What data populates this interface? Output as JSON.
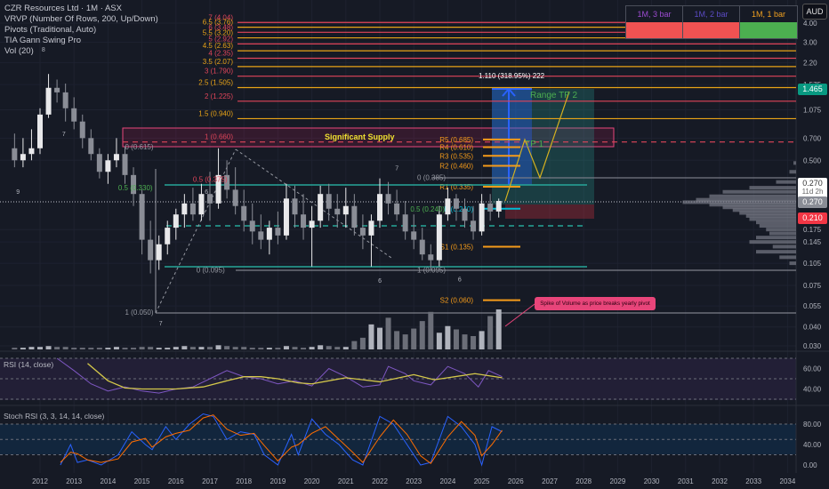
{
  "legend": {
    "symbol": "CZR Resources Ltd · 1M · ASX",
    "indicators": [
      "VRVP (Number Of Rows, 200, Up/Down)",
      "Pivots (Traditional, Auto)",
      "TIA Gann Swing Pro",
      "Vol (20)"
    ]
  },
  "currency": "AUD",
  "bar_table": {
    "headers": [
      "1M, 3 bar",
      "1M, 2 bar",
      "1M, 1 bar"
    ],
    "header_colors": [
      "#9c4bd1",
      "#5b4bc4",
      "#f0a020"
    ],
    "cell_colors": [
      "#f05252",
      "#f05252",
      "#4caf50"
    ]
  },
  "price_badges": {
    "target": "1.465",
    "last": "0.270",
    "countdown": "11d 2h",
    "close": "0.270",
    "stop": "0.210"
  },
  "rsi": {
    "title": "RSI (14, close)"
  },
  "stoch": {
    "title": "Stoch RSI (3, 3, 14, 14, close)"
  },
  "callout": "Spike of Volume as  price breaks yearly pivot",
  "annotations": {
    "significant_supply": "Significant Supply",
    "measure": "1.110 (318.95%) 222",
    "tp2": "Range TP 2",
    "tp1": "TP 1"
  },
  "chart_data": {
    "type": "candlestick",
    "title": "CZR Resources Ltd · 1M · ASX",
    "y_scale": "log",
    "price_axis_ticks": [
      "4.00",
      "3.00",
      "2.20",
      "1.575",
      "1.075",
      "0.700",
      "0.500",
      "0.175",
      "0.145",
      "0.105",
      "0.075",
      "0.055",
      "0.040",
      "0.030"
    ],
    "price_axis_values": [
      4.0,
      3.0,
      2.2,
      1.575,
      1.075,
      0.7,
      0.5,
      0.175,
      0.145,
      0.105,
      0.075,
      0.055,
      0.04,
      0.03
    ],
    "time_axis_ticks": [
      "2012",
      "2013",
      "2014",
      "2015",
      "2016",
      "2017",
      "2018",
      "2019",
      "2020",
      "2021",
      "2022",
      "2023",
      "2024",
      "2025",
      "2026",
      "2027",
      "2028",
      "2029",
      "2030",
      "2031",
      "2032",
      "2033",
      "2034"
    ],
    "ohlc_quarterly": [
      [
        2011.25,
        0.6,
        0.75,
        0.45,
        0.5
      ],
      [
        2011.5,
        0.5,
        0.7,
        0.45,
        0.55
      ],
      [
        2011.75,
        0.55,
        0.8,
        0.5,
        0.6
      ],
      [
        2012.0,
        0.6,
        1.1,
        0.55,
        1.0
      ],
      [
        2012.25,
        1.0,
        1.85,
        0.95,
        1.5
      ],
      [
        2012.5,
        1.5,
        1.7,
        1.2,
        1.4
      ],
      [
        2012.75,
        1.4,
        1.6,
        0.9,
        1.1
      ],
      [
        2013.0,
        1.1,
        1.3,
        0.8,
        0.9
      ],
      [
        2013.25,
        0.9,
        1.0,
        0.6,
        0.7
      ],
      [
        2013.5,
        0.7,
        0.8,
        0.5,
        0.55
      ],
      [
        2013.75,
        0.55,
        0.6,
        0.38,
        0.42
      ],
      [
        2014.0,
        0.42,
        0.55,
        0.35,
        0.5
      ],
      [
        2014.25,
        0.5,
        0.7,
        0.45,
        0.55
      ],
      [
        2014.5,
        0.55,
        0.62,
        0.35,
        0.4
      ],
      [
        2014.75,
        0.4,
        0.45,
        0.25,
        0.3
      ],
      [
        2015.0,
        0.3,
        0.32,
        0.12,
        0.15
      ],
      [
        2015.25,
        0.15,
        0.2,
        0.09,
        0.11
      ],
      [
        2015.5,
        0.11,
        0.16,
        0.095,
        0.14
      ],
      [
        2015.75,
        0.14,
        0.2,
        0.12,
        0.18
      ],
      [
        2016.0,
        0.18,
        0.24,
        0.15,
        0.22
      ],
      [
        2016.25,
        0.22,
        0.3,
        0.18,
        0.26
      ],
      [
        2016.5,
        0.26,
        0.33,
        0.2,
        0.22
      ],
      [
        2016.75,
        0.22,
        0.35,
        0.2,
        0.3
      ],
      [
        2017.0,
        0.3,
        0.42,
        0.2,
        0.26
      ],
      [
        2017.25,
        0.26,
        0.6,
        0.24,
        0.4
      ],
      [
        2017.5,
        0.4,
        0.5,
        0.28,
        0.32
      ],
      [
        2017.75,
        0.32,
        0.45,
        0.22,
        0.25
      ],
      [
        2018.0,
        0.25,
        0.32,
        0.17,
        0.2
      ],
      [
        2018.25,
        0.2,
        0.26,
        0.14,
        0.17
      ],
      [
        2018.5,
        0.17,
        0.22,
        0.13,
        0.15
      ],
      [
        2018.75,
        0.15,
        0.2,
        0.12,
        0.18
      ],
      [
        2019.0,
        0.18,
        0.23,
        0.14,
        0.16
      ],
      [
        2019.25,
        0.16,
        0.35,
        0.15,
        0.28
      ],
      [
        2019.5,
        0.28,
        0.34,
        0.18,
        0.22
      ],
      [
        2019.75,
        0.22,
        0.3,
        0.15,
        0.18
      ],
      [
        2020.0,
        0.18,
        0.25,
        0.1,
        0.2
      ],
      [
        2020.25,
        0.2,
        0.34,
        0.18,
        0.3
      ],
      [
        2020.5,
        0.3,
        0.35,
        0.2,
        0.24
      ],
      [
        2020.75,
        0.24,
        0.3,
        0.18,
        0.22
      ],
      [
        2021.0,
        0.22,
        0.33,
        0.18,
        0.25
      ],
      [
        2021.25,
        0.25,
        0.3,
        0.16,
        0.18
      ],
      [
        2021.5,
        0.18,
        0.22,
        0.13,
        0.16
      ],
      [
        2021.75,
        0.16,
        0.22,
        0.1,
        0.2
      ],
      [
        2022.0,
        0.2,
        0.38,
        0.18,
        0.3
      ],
      [
        2022.25,
        0.3,
        0.36,
        0.22,
        0.26
      ],
      [
        2022.5,
        0.26,
        0.32,
        0.2,
        0.22
      ],
      [
        2022.75,
        0.22,
        0.27,
        0.15,
        0.17
      ],
      [
        2023.0,
        0.17,
        0.22,
        0.13,
        0.15
      ],
      [
        2023.25,
        0.15,
        0.18,
        0.11,
        0.12
      ],
      [
        2023.5,
        0.12,
        0.14,
        0.095,
        0.11
      ],
      [
        2023.75,
        0.11,
        0.25,
        0.1,
        0.22
      ],
      [
        2024.0,
        0.22,
        0.33,
        0.2,
        0.28
      ],
      [
        2024.25,
        0.28,
        0.3,
        0.2,
        0.24
      ],
      [
        2024.5,
        0.24,
        0.28,
        0.18,
        0.2
      ],
      [
        2024.75,
        0.2,
        0.25,
        0.15,
        0.17
      ],
      [
        2025.0,
        0.17,
        0.3,
        0.16,
        0.26
      ],
      [
        2025.25,
        0.26,
        0.3,
        0.2,
        0.23
      ],
      [
        2025.5,
        0.23,
        0.28,
        0.21,
        0.27
      ]
    ],
    "volume_relative": [
      2,
      2,
      3,
      3,
      4,
      3,
      3,
      2,
      2,
      2,
      2,
      2,
      3,
      2,
      2,
      3,
      3,
      2,
      2,
      3,
      4,
      3,
      3,
      3,
      5,
      4,
      3,
      3,
      2,
      2,
      2,
      2,
      4,
      3,
      2,
      3,
      5,
      4,
      3,
      3,
      10,
      14,
      30,
      26,
      38,
      22,
      18,
      25,
      34,
      45,
      20,
      28,
      24,
      18,
      16,
      22,
      40,
      48
    ],
    "gann_levels": [
      {
        "label": "7 (4.04)",
        "price": 4.04,
        "color": "#e0455a"
      },
      {
        "label": "6.5 (3.76)",
        "price": 3.76,
        "color": "#e8a317"
      },
      {
        "label": "6 (3.48)",
        "price": 3.48,
        "color": "#e0455a"
      },
      {
        "label": "5.5 (3.20)",
        "price": 3.2,
        "color": "#e8a317"
      },
      {
        "label": "5 (2.92)",
        "price": 2.92,
        "color": "#e0455a"
      },
      {
        "label": "4.5 (2.63)",
        "price": 2.63,
        "color": "#e8a317"
      },
      {
        "label": "4 (2.35)",
        "price": 2.35,
        "color": "#e0455a"
      },
      {
        "label": "3.5 (2.07)",
        "price": 2.07,
        "color": "#e8a317"
      },
      {
        "label": "3 (1.790)",
        "price": 1.79,
        "color": "#e0455a"
      },
      {
        "label": "2.5 (1.505)",
        "price": 1.505,
        "color": "#e8a317"
      },
      {
        "label": "2 (1.225)",
        "price": 1.225,
        "color": "#e0455a"
      },
      {
        "label": "1.5 (0.940)",
        "price": 0.94,
        "color": "#e8a317"
      },
      {
        "label": "1 (0.660)",
        "price": 0.66,
        "color": "#e0455a"
      }
    ],
    "pivots": [
      {
        "label": "R5 (0.685)",
        "price": 0.685
      },
      {
        "label": "R4 (0.610)",
        "price": 0.61
      },
      {
        "label": "R3 (0.535)",
        "price": 0.535
      },
      {
        "label": "R2 (0.460)",
        "price": 0.46
      },
      {
        "label": "R1 (0.335)",
        "price": 0.335
      },
      {
        "label": "P (0.240)",
        "price": 0.24
      },
      {
        "label": "S1 (0.135)",
        "price": 0.135
      },
      {
        "label": "S2 (0.060)",
        "price": 0.06
      }
    ],
    "fib_labels": [
      {
        "label": "0 (0.615)",
        "price": 0.615,
        "t": 2014.5,
        "color": "#9598a1"
      },
      {
        "label": "0.5 (0.375)",
        "price": 0.375,
        "t": 2016.5,
        "color": "#e0455a"
      },
      {
        "label": "0.5 (0.330)",
        "price": 0.33,
        "t": 2014.3,
        "color": "#4caf50"
      },
      {
        "label": "0 (0.095)",
        "price": 0.095,
        "t": 2016.6,
        "color": "#9598a1"
      },
      {
        "label": "1 (0.050)",
        "price": 0.05,
        "t": 2014.5,
        "color": "#9598a1"
      },
      {
        "label": "0 (0.385)",
        "price": 0.385,
        "t": 2023.1,
        "color": "#9598a1"
      },
      {
        "label": "0.5 (0.240)",
        "price": 0.24,
        "t": 2022.9,
        "color": "#4caf50"
      },
      {
        "label": "1 (0.095)",
        "price": 0.095,
        "t": 2023.1,
        "color": "#9598a1"
      }
    ],
    "swing_counts": [
      {
        "label": "8",
        "t": 2012.05,
        "price": 2.6
      },
      {
        "label": "7",
        "t": 2012.65,
        "price": 0.72
      },
      {
        "label": "9",
        "t": 2011.3,
        "price": 0.3
      },
      {
        "label": "7",
        "t": 2015.5,
        "price": 0.041
      },
      {
        "label": "6",
        "t": 2016.85,
        "price": 0.3
      },
      {
        "label": "7",
        "t": 2022.45,
        "price": 0.43
      },
      {
        "label": "6",
        "t": 2021.95,
        "price": 0.078
      },
      {
        "label": "6",
        "t": 2024.3,
        "price": 0.08
      }
    ],
    "vrvp": [
      [
        0.48,
        4
      ],
      [
        0.42,
        10
      ],
      [
        0.36,
        30
      ],
      [
        0.33,
        70
      ],
      [
        0.31,
        110
      ],
      [
        0.29,
        130
      ],
      [
        0.275,
        150
      ],
      [
        0.265,
        170
      ],
      [
        0.255,
        130
      ],
      [
        0.245,
        110
      ],
      [
        0.235,
        95
      ],
      [
        0.225,
        85
      ],
      [
        0.215,
        75
      ],
      [
        0.205,
        70
      ],
      [
        0.195,
        60
      ],
      [
        0.185,
        55
      ],
      [
        0.175,
        45
      ],
      [
        0.165,
        40
      ],
      [
        0.155,
        60
      ],
      [
        0.145,
        70
      ],
      [
        0.135,
        35
      ],
      [
        0.125,
        60
      ],
      [
        0.115,
        25
      ],
      [
        0.105,
        10
      ]
    ],
    "rsi": {
      "ticks": [
        "60.00",
        "40.00"
      ],
      "tick_values": [
        60,
        40
      ],
      "bands": [
        70,
        50,
        30
      ],
      "line": [
        [
          2012.5,
          70
        ],
        [
          2013,
          58
        ],
        [
          2013.5,
          45
        ],
        [
          2014,
          38
        ],
        [
          2014.5,
          42
        ],
        [
          2015,
          38
        ],
        [
          2015.5,
          36
        ],
        [
          2016,
          40
        ],
        [
          2016.5,
          42
        ],
        [
          2017,
          50
        ],
        [
          2017.5,
          58
        ],
        [
          2018,
          52
        ],
        [
          2018.5,
          50
        ],
        [
          2019,
          45
        ],
        [
          2019.5,
          48
        ],
        [
          2020,
          43
        ],
        [
          2020.5,
          60
        ],
        [
          2021,
          52
        ],
        [
          2021.5,
          42
        ],
        [
          2022,
          44
        ],
        [
          2022.25,
          62
        ],
        [
          2022.75,
          55
        ],
        [
          2023,
          48
        ],
        [
          2023.5,
          44
        ],
        [
          2024,
          62
        ],
        [
          2024.5,
          55
        ],
        [
          2024.9,
          42
        ],
        [
          2025.2,
          58
        ],
        [
          2025.6,
          52
        ]
      ],
      "ma": [
        [
          2013.4,
          65
        ],
        [
          2014,
          48
        ],
        [
          2014.5,
          41
        ],
        [
          2015,
          40
        ],
        [
          2016,
          40
        ],
        [
          2016.8,
          42
        ],
        [
          2017.5,
          48
        ],
        [
          2018,
          52
        ],
        [
          2018.5,
          52
        ],
        [
          2019,
          50
        ],
        [
          2019.6,
          46
        ],
        [
          2020,
          45
        ],
        [
          2021,
          51
        ],
        [
          2021.5,
          49
        ],
        [
          2022,
          47
        ],
        [
          2023,
          54
        ],
        [
          2023.6,
          49
        ],
        [
          2024,
          51
        ],
        [
          2024.8,
          55
        ],
        [
          2025.6,
          51
        ]
      ]
    },
    "stoch_rsi": {
      "ticks": [
        "80.00",
        "40.00",
        "0.00"
      ],
      "tick_values": [
        80,
        40,
        0
      ],
      "bands": [
        80,
        50,
        20
      ],
      "x": [
        2012.6,
        2012.9,
        2013.1,
        2013.4,
        2013.8,
        2014.3,
        2014.7,
        2015.1,
        2015.3,
        2015.7,
        2016.0,
        2016.4,
        2016.8,
        2017.1,
        2017.5,
        2017.9,
        2018.3,
        2018.6,
        2019.0,
        2019.4,
        2019.6,
        2020.0,
        2020.4,
        2020.8,
        2021.2,
        2021.5,
        2022.0,
        2022.4,
        2022.8,
        2023.2,
        2023.5,
        2024.0,
        2024.4,
        2024.8,
        2025.0,
        2025.3,
        2025.6
      ],
      "k": [
        0,
        40,
        5,
        10,
        0,
        20,
        65,
        40,
        30,
        75,
        50,
        80,
        100,
        95,
        50,
        65,
        60,
        20,
        0,
        60,
        20,
        90,
        60,
        40,
        10,
        0,
        95,
        80,
        40,
        0,
        5,
        95,
        75,
        40,
        0,
        75,
        65
      ],
      "d": [
        5,
        25,
        22,
        10,
        5,
        12,
        45,
        52,
        35,
        55,
        62,
        68,
        92,
        98,
        70,
        58,
        62,
        38,
        8,
        35,
        40,
        62,
        75,
        50,
        25,
        5,
        55,
        88,
        60,
        18,
        3,
        55,
        85,
        58,
        18,
        40,
        68
      ]
    }
  }
}
